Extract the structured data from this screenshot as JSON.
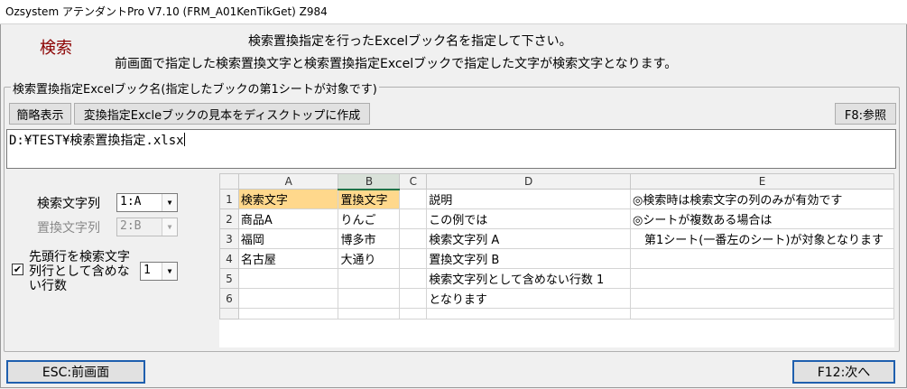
{
  "window": {
    "title": "Ozsystem アテンダントPro V7.10 (FRM_A01KenTikGet)  Z984"
  },
  "header": {
    "title": "検索",
    "instruction_line1": "検索置換指定を行ったExcelブック名を指定して下さい。",
    "instruction_line2": "前画面で指定した検索置換文字と検索置換指定Excelブックで指定した文字が検索文字となります。"
  },
  "group": {
    "title": "検索置換指定Excelブック名(指定したブックの第1シートが対象です)"
  },
  "toolbar": {
    "simple_label": "簡略表示",
    "create_sample_label": "変換指定Excleブックの見本をディスクトップに作成",
    "f8_label": "F8:参照"
  },
  "file": {
    "path": "D:¥TEST¥検索置換指定.xlsx"
  },
  "options": {
    "search_col_label": "検索文字列",
    "search_col_value": "1:A",
    "replace_col_label": "置換文字列",
    "replace_col_value": "2:B",
    "skip_rows_label": "先頭行を検索文字列行として含めない行数",
    "skip_rows_checked": true,
    "skip_rows_value": "1"
  },
  "sheet": {
    "columns": [
      "A",
      "B",
      "C",
      "D",
      "E"
    ],
    "rows": [
      {
        "num": "1",
        "cells": [
          "検索文字",
          "置換文字",
          "",
          "説明",
          "◎検索時は検索文字の列のみが有効です"
        ]
      },
      {
        "num": "2",
        "cells": [
          "商品A",
          "りんご",
          "",
          "この例では",
          "◎シートが複数ある場合は"
        ]
      },
      {
        "num": "3",
        "cells": [
          "福岡",
          "博多市",
          "",
          "検索文字列 A",
          "　第1シート(一番左のシート)が対象となります"
        ]
      },
      {
        "num": "4",
        "cells": [
          "名古屋",
          "大通り",
          "",
          "置換文字列 B",
          ""
        ]
      },
      {
        "num": "5",
        "cells": [
          "",
          "",
          "",
          "検索文字列として含めない行数 1",
          ""
        ]
      },
      {
        "num": "6",
        "cells": [
          "",
          "",
          "",
          "となります",
          ""
        ]
      }
    ]
  },
  "footer": {
    "esc_label": "ESC:前画面",
    "f12_label": "F12:次へ"
  },
  "colors": {
    "title_red": "#8b0000",
    "header_highlight": "#ffd88c",
    "focus_blue": "#1f5fae"
  }
}
